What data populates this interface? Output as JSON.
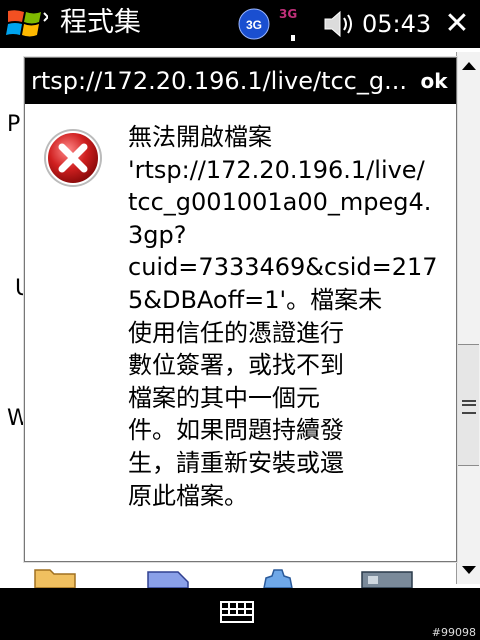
{
  "statusbar": {
    "title": "程式集",
    "network": "3G",
    "signal_label": "3G",
    "time": "05:43",
    "close_glyph": "✕"
  },
  "background": {
    "letters": [
      "P",
      "U",
      "W"
    ]
  },
  "dialog": {
    "title": "rtsp://172.20.196.1/live/tcc_g...",
    "ok_label": "ok",
    "message_lines": [
      "無法開啟檔案",
      "'rtsp://172.20.196.1/live/",
      "tcc_g001001a00_mpeg4.",
      "3gp?",
      "cuid=7333469&csid=217",
      "5&DBAoff=1'。檔案未",
      "使用信任的憑證進行",
      "數位簽署，或找不到",
      "檔案的其中一個元",
      "件。如果問題持續發",
      "生，請重新安裝或還",
      "原此檔案。"
    ]
  },
  "bottombar": {
    "watermark": "#99098"
  },
  "colors": {
    "bar_background": "#000000",
    "error_red": "#d02020",
    "network_blue": "#1a4fd0",
    "signal_label": "#c0307a"
  }
}
